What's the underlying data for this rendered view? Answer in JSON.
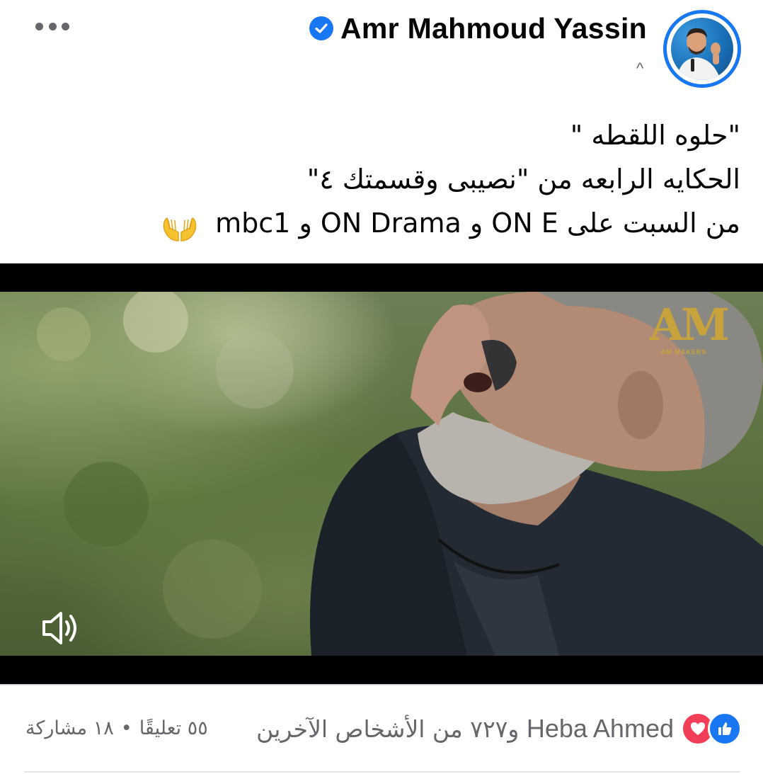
{
  "header": {
    "author_name": "Amr Mahmoud Yassin",
    "time_glyph": "^",
    "verified_icon": "verified-badge-icon",
    "more_icon": "more-dots-icon"
  },
  "post": {
    "lines": [
      "\"حلوه اللقطه \"",
      "الحكايه الرابعه من \"نصيبى وقسمتك ٤\"",
      "من السبت على ON E و ON Drama و mbc1"
    ],
    "emoji": "palms-up-together-emoji"
  },
  "video": {
    "watermark_letters": "AM",
    "watermark_sub": "AM MAKERS",
    "mute_icon": "volume-icon"
  },
  "reactions": {
    "icons": [
      "like-icon",
      "love-icon"
    ],
    "names": "Heba Ahmed",
    "others": "و٧٢٧ من الأشخاص الآخرين"
  },
  "counts": {
    "comments": "٥٥ تعليقًا",
    "separator": "•",
    "shares": "١٨ مشاركة"
  },
  "colors": {
    "brand_blue": "#1877f2",
    "love_red": "#f33e58",
    "secondary_text": "#65676b"
  }
}
